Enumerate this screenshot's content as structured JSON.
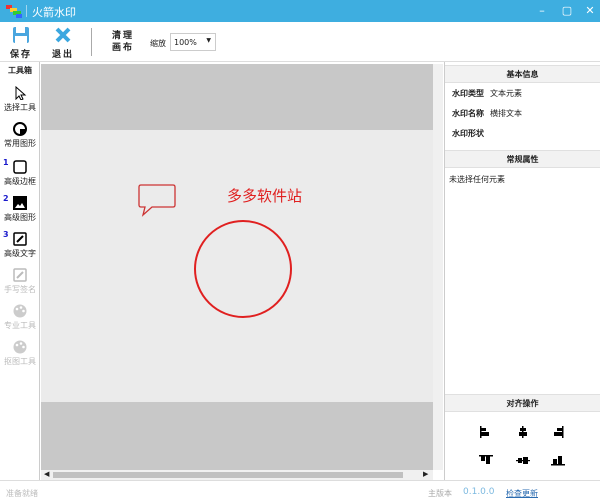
{
  "window": {
    "title": "火箭水印",
    "minimize": "–",
    "maximize": "▢",
    "close": "✕"
  },
  "toolbar": {
    "save": "保存",
    "exit": "退出",
    "clear_line1": "清理",
    "clear_line2": "画布",
    "zoom_label": "缩放",
    "zoom_value": "100%"
  },
  "toolbox": {
    "title": "工具箱",
    "items": [
      {
        "label": "选择工具",
        "num": ""
      },
      {
        "label": "常用图形",
        "num": ""
      },
      {
        "label": "高级边框",
        "num": "1"
      },
      {
        "label": "高级图形",
        "num": "2"
      },
      {
        "label": "高级文字",
        "num": "3"
      },
      {
        "label": "手写签名",
        "num": ""
      },
      {
        "label": "专业工具",
        "num": ""
      },
      {
        "label": "抠图工具",
        "num": ""
      }
    ]
  },
  "canvas": {
    "text": "多多软件站",
    "accent": "#e02020"
  },
  "right": {
    "basic_title": "基本信息",
    "props": [
      {
        "k": "水印类型",
        "v": "文本元素"
      },
      {
        "k": "水印名称",
        "v": "横排文本"
      },
      {
        "k": "水印形状",
        "v": ""
      }
    ],
    "general_title": "常规属性",
    "general_text": "未选择任何元素",
    "align_title": "对齐操作"
  },
  "status": {
    "ready": "准备就绪",
    "version_label": "主版本",
    "version": "0.1.0.0",
    "check_update": "检查更新"
  }
}
